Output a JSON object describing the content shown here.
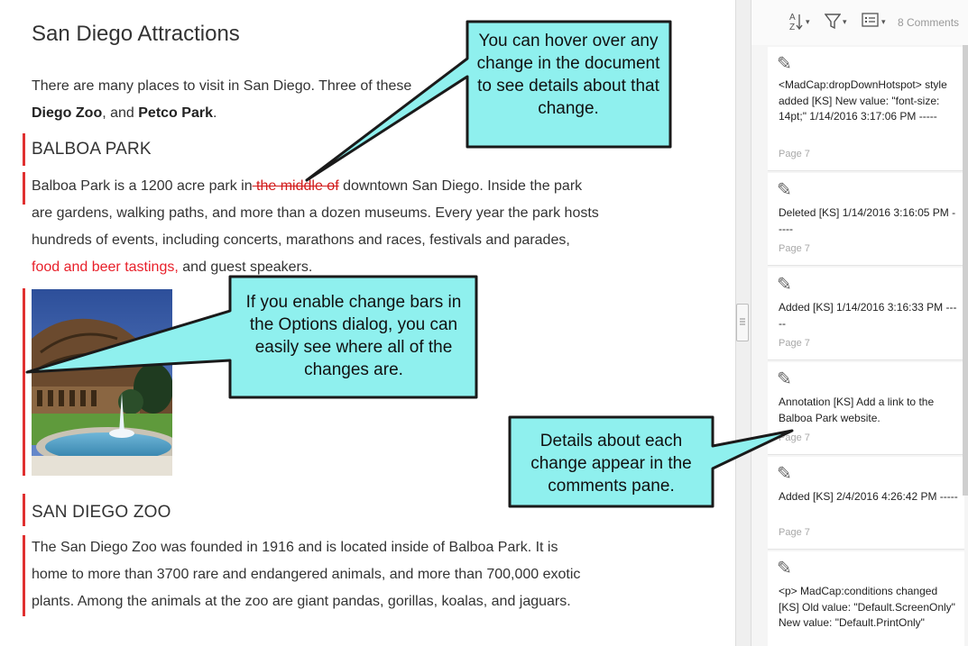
{
  "document": {
    "title": "San Diego Attractions",
    "intro": {
      "text1": "There are many places to visit in San Diego. Three of these",
      "zoo": "Diego Zoo",
      "comma": ", and ",
      "petco": "Petco Park",
      "period": "."
    },
    "balboa": {
      "heading": "BALBOA PARK",
      "line1_pre": "Balboa Park is a 1200 acre park in",
      "line1_deleted": " the middle of",
      "line1_post": " downtown San Diego. Inside the park",
      "line2": "are gardens, walking paths, and more than a dozen museums. Every year the park hosts",
      "line3": "hundreds of events, including concerts, marathons and races, festivals and parades,",
      "line4_inserted": "food and beer tastings,",
      "line4_post": " and guest speakers."
    },
    "zoo_section": {
      "heading": "SAN DIEGO ZOO",
      "line1": "The San Diego Zoo was founded in 1916 and is located inside of Balboa Park. It is",
      "line2": "home to more than 3700 rare and endangered animals, and more than 700,000 exotic",
      "line3": "plants. Among the animals at the zoo are giant pandas, gorillas, koalas, and jaguars."
    }
  },
  "comments_pane": {
    "count_label": "8 Comments",
    "toolbar": {
      "sort_icon": "sort-az-icon",
      "filter_icon": "filter-icon",
      "view_icon": "list-view-icon"
    },
    "items": [
      {
        "text": "<MadCap:dropDownHotspot> style added [KS] New value: \"font-size: 14pt;\" 1/14/2016 3:17:06 PM -----",
        "page": "Page 7"
      },
      {
        "text": "Deleted [KS] 1/14/2016 3:16:05 PM -----",
        "page": "Page 7"
      },
      {
        "text": "Added [KS] 1/14/2016 3:16:33 PM -----",
        "page": "Page 7"
      },
      {
        "text": "Annotation [KS] Add a link to the Balboa Park website.",
        "page": "Page 7"
      },
      {
        "text": "Added [KS] 2/4/2016 4:26:42 PM -----",
        "page": "Page 7"
      },
      {
        "text": "<p> MadCap:conditions changed [KS] Old value: \"Default.ScreenOnly\" New value: \"Default.PrintOnly\"",
        "page": ""
      }
    ]
  },
  "callouts": {
    "hover": "You can hover over any change in the document to see details about that change.",
    "bars": "If you enable change bars in the Options dialog, you can easily see where all of the changes are.",
    "pane": "Details about each change appear in the comments pane."
  },
  "colors": {
    "callout_fill": "#8ff0ee",
    "change_bar": "#e03030",
    "inserted_text": "#e8202a"
  }
}
